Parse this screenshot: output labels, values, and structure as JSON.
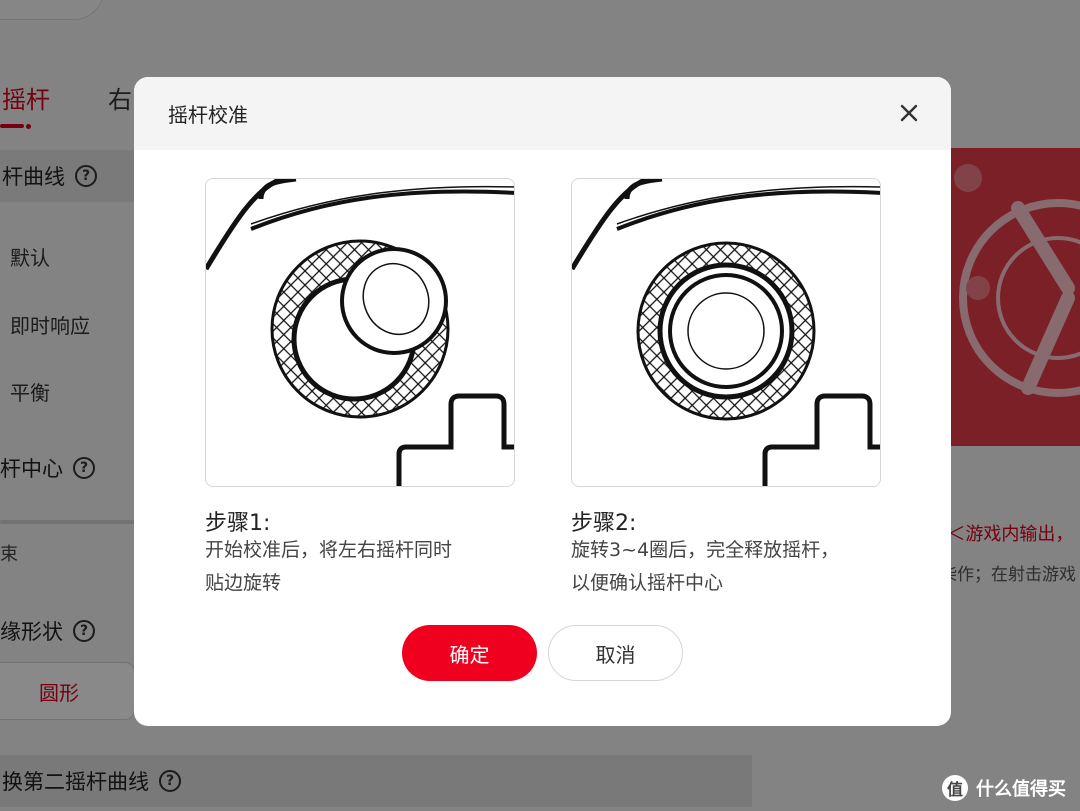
{
  "background": {
    "tabs": [
      "摇杆",
      "右"
    ],
    "curve_section": "杆曲线",
    "curve_options": [
      "默认",
      "即时响应",
      "平衡"
    ],
    "center_section": "杆中心",
    "slider_end": "束",
    "edge_section": "缘形状",
    "shape_value": "圆形",
    "second_curve_section": "换第二摇杆曲线",
    "red_text": "ŋ＜游戏内输出，",
    "gray_text": "柴作；在射击游戏",
    "help_glyph": "?"
  },
  "dialog": {
    "title": "摇杆校准",
    "close_icon": "close-icon",
    "steps": [
      {
        "title": "步骤1:",
        "description_lines": [
          "开始校准后，将左右摇杆同时",
          "贴边旋转"
        ]
      },
      {
        "title": "步骤2:",
        "description_lines": [
          "旋转3~4圈后，完全释放摇杆，",
          "以便确认摇杆中心"
        ]
      }
    ],
    "confirm_label": "确定",
    "cancel_label": "取消"
  },
  "watermark": {
    "logo_glyph": "值",
    "text": "什么值得买"
  },
  "colors": {
    "accent": "#f0001e",
    "overlay": "rgba(0,0,0,0.45)"
  }
}
